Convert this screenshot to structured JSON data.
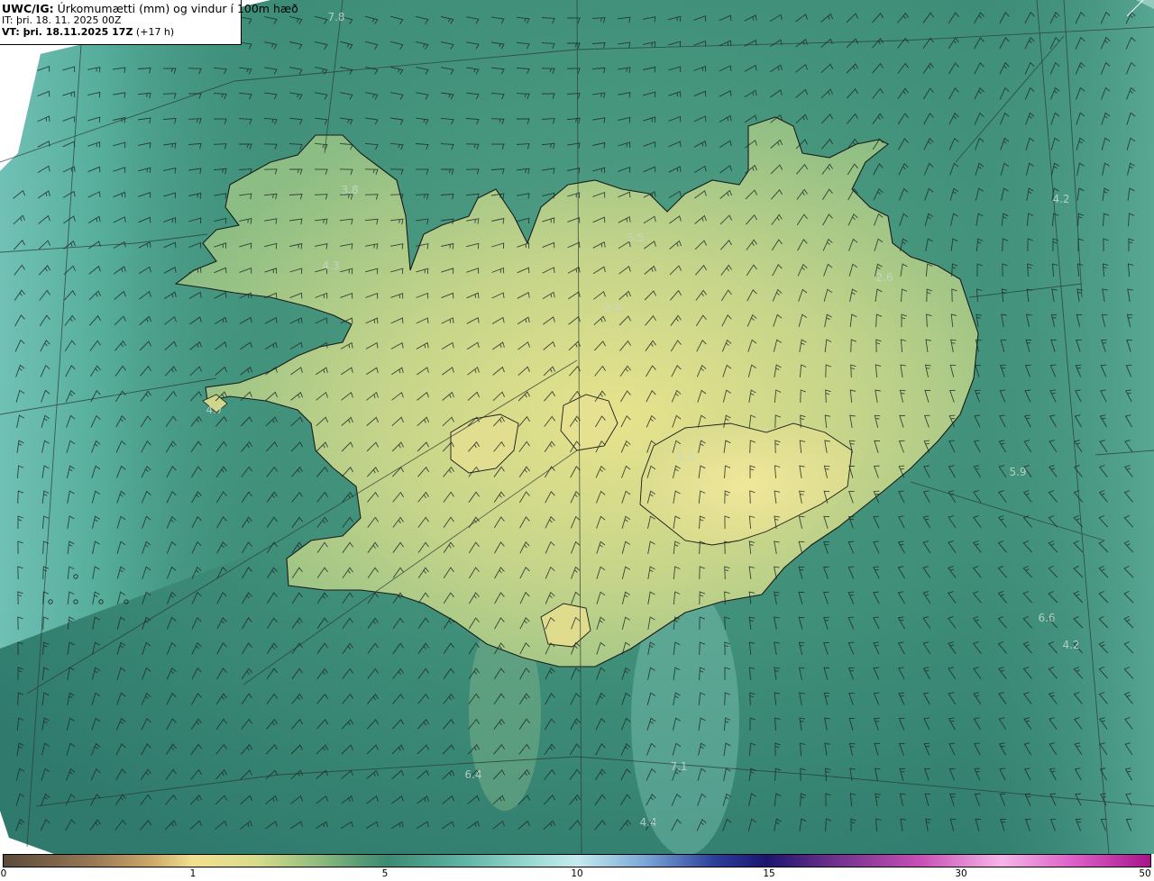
{
  "header": {
    "title_prefix": "UWC/IG:",
    "title_text": " Úrkomumætti (mm) og vindur í 100m hæð",
    "it_line": "IT: þri. 18. 11. 2025 00Z",
    "vt_bold": "VT: þri. 18.11.2025 17Z",
    "vt_offset": " (+17 h)"
  },
  "map_labels": [
    {
      "name": "value-7-8",
      "text": "7.8"
    },
    {
      "name": "value-3-8",
      "text": "3.8"
    },
    {
      "name": "value-4-3",
      "text": "4.3"
    },
    {
      "name": "value-4-7",
      "text": "4.7"
    },
    {
      "name": "value-5-5",
      "text": "5.5"
    },
    {
      "name": "value-2-4",
      "text": "2.4"
    },
    {
      "name": "value-2-6",
      "text": "2.6"
    },
    {
      "name": "value-4-2-east",
      "text": "4.2"
    },
    {
      "name": "value-1-2",
      "text": "1.2"
    },
    {
      "name": "value-5-9",
      "text": "5.9"
    },
    {
      "name": "value-6-6",
      "text": "6.6"
    },
    {
      "name": "value-4-2-southeast",
      "text": "4.2"
    },
    {
      "name": "value-6-4",
      "text": "6.4"
    },
    {
      "name": "value-7-1",
      "text": "7.1"
    },
    {
      "name": "value-4-4",
      "text": "4.4"
    }
  ],
  "colorbar": {
    "ticks": [
      "0",
      "1",
      "5",
      "10",
      "15",
      "30",
      "50"
    ]
  },
  "colors": {
    "land_high": "#e4e08c",
    "land_low": "#8fbf86",
    "sea": "#3e8e78",
    "coast": "#1a1a1a"
  }
}
